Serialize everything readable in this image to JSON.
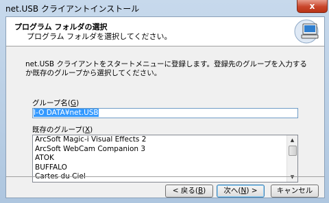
{
  "window": {
    "title": "net.USB クライアントインストール",
    "close_glyph": "x"
  },
  "header": {
    "title": "プログラム フォルダの選択",
    "subtitle": "プログラム フォルダを選択してください。",
    "icon": "cd-computer-icon"
  },
  "content": {
    "description": "net.USB クライアントをスタートメニューに登録します。登録先のグループを入力するか既存のグループから選択してください。",
    "group_label": {
      "text": "グループ名(",
      "accel": "G",
      "end": ")"
    },
    "group_value": "I-O DATA¥net.USB",
    "existing_label": {
      "text": "既存のグループ(",
      "accel": "X",
      "end": ")"
    },
    "existing_groups": [
      "ArcSoft Magic-i Visual Effects 2",
      "ArcSoft WebCam Companion 3",
      "ATOK",
      "BUFFALO",
      "Cartes du Ciel"
    ]
  },
  "buttons": {
    "back": {
      "text": "< 戻る(",
      "accel": "B",
      "end": ")"
    },
    "next": {
      "text": "次へ(",
      "accel": "N",
      "end": ") >"
    },
    "cancel": "キャンセル"
  },
  "colors": {
    "selection": "#3399ff",
    "titlebar_close": "#c9452a"
  }
}
